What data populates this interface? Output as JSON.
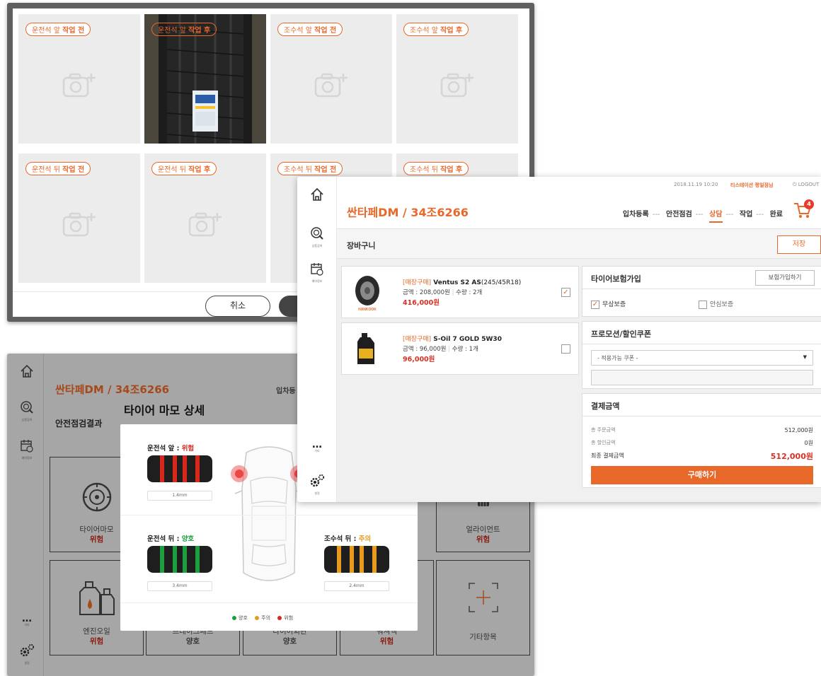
{
  "photo_panel": {
    "slots": [
      {
        "label": "운전석 앞",
        "state": "작업 전"
      },
      {
        "label": "운전석 앞",
        "state": "작업 후"
      },
      {
        "label": "조수석 앞",
        "state": "작업 전"
      },
      {
        "label": "조수석 앞",
        "state": "작업 후"
      },
      {
        "label": "운전석 뒤",
        "state": "작업 전"
      },
      {
        "label": "운전석 뒤",
        "state": "작업 후"
      },
      {
        "label": "조수석 뒤",
        "state": "작업 전"
      },
      {
        "label": "조수석 뒤",
        "state": "작업 후"
      }
    ],
    "cancel_label": "취소"
  },
  "cart_panel": {
    "topbar": {
      "datetime": "2018.11.19 10:20",
      "shop": "티스테이션 평일점님",
      "logout": "LOGOUT"
    },
    "car_title": "싼타페DM / 34조6266",
    "steps": [
      "입차등록",
      "안전점검",
      "상담",
      "작업",
      "완료"
    ],
    "active_step": "상담",
    "cart_count": "4",
    "section_title": "장바구니",
    "save_label": "저장",
    "sidebar": [
      "상품검색",
      "예약정보",
      "기타",
      "설정"
    ],
    "items": [
      {
        "type": "[매장구매]",
        "name": "Ventus S2 AS",
        "spec": "(245/45R18)",
        "price": "금액 : 208,000원",
        "qty": "수량 : 2개",
        "total": "416,000원",
        "checked": true
      },
      {
        "type": "[매장구매]",
        "name": "S-Oil 7 GOLD 5W30",
        "spec": "",
        "price": "금액 : 96,000원",
        "qty": "수량 : 1개",
        "total": "96,000원",
        "checked": false
      }
    ],
    "insurance": {
      "title": "타이어보험가입",
      "button": "보험가입하기",
      "options": [
        "무상보증",
        "안심보증"
      ]
    },
    "promotion": {
      "title": "프로모션/할인쿠폰",
      "select_value": "- 적용가능 쿠폰 -"
    },
    "payment": {
      "title": "결제금액",
      "rows": [
        {
          "label": "총 주문금액",
          "value": "512,000원"
        },
        {
          "label": "총 할인금액",
          "value": "0원"
        },
        {
          "label": "최종 결제금액",
          "value": "512,000원"
        }
      ],
      "buy_label": "구매하기"
    },
    "brand_label": "HANKOOK"
  },
  "safety_panel": {
    "car_title": "싼타페DM / 34조6266",
    "step_label": "입차등",
    "section_title": "안전점검결과",
    "modal_title": "타이어 마모 상세",
    "tires": [
      {
        "label": "운전석 앞 : ",
        "status": "위험",
        "depth": "1.4mm",
        "color": "#d8281e"
      },
      {
        "label": "운전석 뒤 : ",
        "status": "양호",
        "depth": "3.4mm",
        "color": "#1e9e3e"
      },
      {
        "label": "조수석 뒤 : ",
        "status": "주의",
        "depth": "2.4mm",
        "color": "#e89a1e"
      }
    ],
    "legend": [
      "양호",
      "주의",
      "위험"
    ],
    "tiles": [
      {
        "name": "타이어마모",
        "status": "위험"
      },
      {
        "name": "얼라이먼트",
        "status": "위험"
      },
      {
        "name": "엔진오일",
        "status": "위험"
      },
      {
        "name": "브레이크패드",
        "status": "양호"
      },
      {
        "name": "타이어외관",
        "status": "양호"
      },
      {
        "name": "워셔액",
        "status": "위험"
      },
      {
        "name": "기타항목",
        "status": ""
      }
    ],
    "sidebar": [
      "상품검색",
      "예약정보",
      "기타",
      "설정"
    ]
  }
}
